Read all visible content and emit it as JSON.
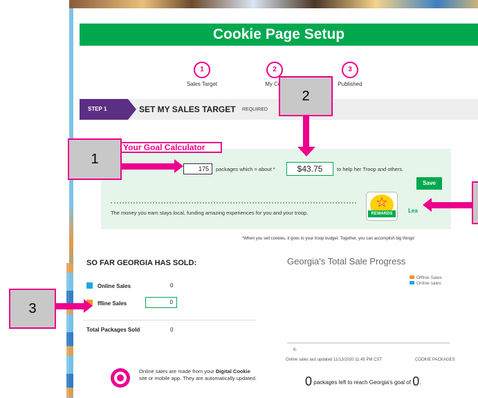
{
  "page": {
    "title": "Cookie Page Setup"
  },
  "steps": [
    {
      "number": "1",
      "label": "Sales Target"
    },
    {
      "number": "2",
      "label": "My Coo"
    },
    {
      "number": "3",
      "label": "Published"
    }
  ],
  "step_bar": {
    "badge": "STEP 1",
    "title": "SET MY SALES TARGET",
    "required": "REQUIRED"
  },
  "goal_calculator": {
    "tab_label": "Your Goal Calculator",
    "packages_value": "175",
    "packages_text": "packages which = about *",
    "money_value": "$43.75",
    "help_text": "to help her Troop and others.",
    "save_label": "Save",
    "money_note": "The money you earn stays local, funding amazing experiences for you and your troop.",
    "rewards_label": "REWARDS",
    "learn_label": "Lea"
  },
  "footnote": "*When you sell cookies, it goes to your troop budget. Together, you can accomplish big things!",
  "sales": {
    "title": "SO FAR GEORGIA HAS SOLD:",
    "online_label": "Online Sales",
    "online_value": "0",
    "offline_label": "ffline Sales",
    "offline_value": "0",
    "total_label": "Total Packages Sold",
    "total_value": "0",
    "online_color": "#1ea7e1",
    "offline_color": "#f7941d"
  },
  "progress_chart": {
    "title": "Georgia's Total Sale Progress",
    "legend": [
      {
        "label": "Offline Sales",
        "color": "#f7941d"
      },
      {
        "label": "Online sales",
        "color": "#1ea7e1"
      }
    ],
    "zero_label": "0-",
    "updated_text": "Online sales last updated 11/13/2020 11:45 PM CST",
    "axis_label": "COOKIE PACKAGES",
    "left_count": "0",
    "left_text": "packages left to reach Georgia's goal of",
    "goal_value": "0",
    "period": "."
  },
  "online_note": {
    "text_before": "Online sales are made from your",
    "bold": "Digital Cookie",
    "text_after": "site or mobile app. They are automatically updated."
  },
  "callouts": {
    "one": "1",
    "two": "2",
    "three": "3"
  },
  "colors": {
    "brand_green": "#00a94f",
    "accent_pink": "#ec008c",
    "step_purple": "#5a2f84"
  }
}
